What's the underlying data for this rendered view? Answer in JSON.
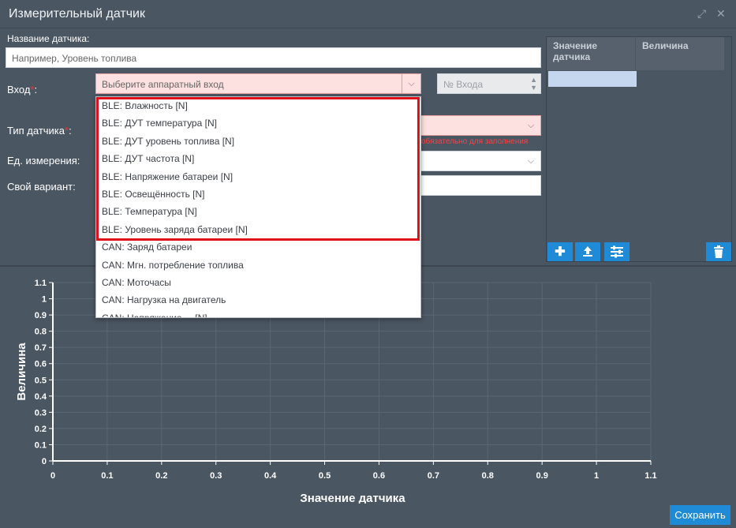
{
  "window": {
    "title": "Измерительный датчик"
  },
  "form": {
    "name_label": "Название датчика:",
    "name_placeholder": "Например, Уровень топлива",
    "input_label": "Вход",
    "input_select_placeholder": "Выберите аппаратный вход",
    "input_number_placeholder": "№ Входа",
    "type_label": "Тип датчика",
    "type_hint": "обязательно для заполнения",
    "unit_label": "Ед. измерения:",
    "custom_label": "Свой вариант:"
  },
  "dropdown": {
    "items": [
      "BLE: Влажность [N]",
      "BLE: ДУТ температура [N]",
      "BLE: ДУТ уровень топлива [N]",
      "BLE: ДУТ частота [N]",
      "BLE: Напряжение батареи [N]",
      "BLE: Освещённость [N]",
      "BLE: Температура [N]",
      "BLE: Уровень заряда батареи [N]",
      "CAN: Заряд батареи",
      "CAN: Мгн. потребление топлива",
      "CAN: Моточасы",
      "CAN: Нагрузка на двигатель",
      "CAN: Напряжение ... [N]"
    ]
  },
  "table": {
    "col1": "Значение датчика",
    "col2": "Величина",
    "icons": [
      "plus-icon",
      "upload-icon",
      "settings-sliders-icon",
      "trash-icon"
    ]
  },
  "chart_data": {
    "type": "line",
    "title": "",
    "xlabel": "Значение датчика",
    "ylabel": "Величина",
    "xlim": [
      0,
      1.1
    ],
    "ylim": [
      0,
      1.1
    ],
    "x_ticks": [
      "0",
      "0.1",
      "0.2",
      "0.3",
      "0.4",
      "0.5",
      "0.6",
      "0.7",
      "0.8",
      "0.9",
      "1",
      "1.1"
    ],
    "y_ticks": [
      "0",
      "0.1",
      "0.2",
      "0.3",
      "0.4",
      "0.5",
      "0.6",
      "0.7",
      "0.8",
      "0.9",
      "1",
      "1.1"
    ],
    "grid": true,
    "series": []
  },
  "footer": {
    "save_label": "Сохранить"
  }
}
